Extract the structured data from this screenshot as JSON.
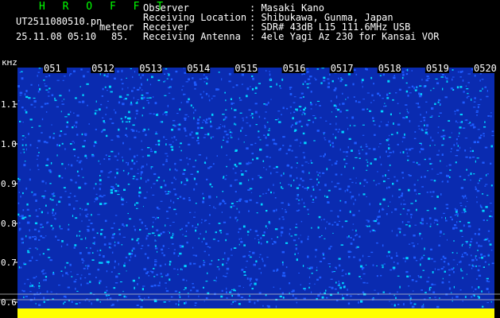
{
  "header": {
    "brand": "H R O F F T",
    "filename": "UT2511080510.pn",
    "meteor_label": "meteor",
    "datetime": "25.11.08 05:10",
    "level": "85."
  },
  "info": [
    {
      "key": "Observer",
      "value": ": Masaki Kano"
    },
    {
      "key": "Receiving Location",
      "value": ": Shibukawa, Gunma, Japan"
    },
    {
      "key": "Receiver",
      "value": ": SDR# 43dB L15 111.6MHz USB"
    },
    {
      "key": "Receiving Antenna",
      "value": ": 4ele Yagi Az 230 for Kansai VOR"
    }
  ],
  "spectrogram": {
    "y_unit": "kHz",
    "y_ticks": [
      "1.1",
      "1.0",
      "0.9",
      "0.8",
      "0.7",
      "0.6"
    ],
    "time_ticks": [
      "051",
      "0512",
      "0513",
      "0514",
      "0515",
      "0516",
      "0517",
      "0518",
      "0519",
      "0520"
    ],
    "colors": {
      "background": "#0a2bb0",
      "noise_a": "#1e5cff",
      "noise_b": "#00d4ff",
      "baseline": "#ffff00"
    }
  }
}
